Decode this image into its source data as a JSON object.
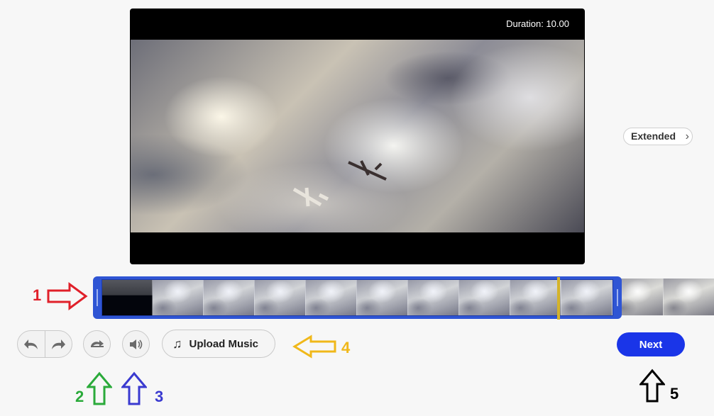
{
  "player": {
    "duration_label": "Duration: 10.00"
  },
  "extended": {
    "label": "Extended",
    "chevron": "›"
  },
  "timeline": {
    "thumbnail_count": 12,
    "playhead_icon": "playhead-marker"
  },
  "controls": {
    "undo_icon": "undo-icon",
    "redo_icon": "redo-icon",
    "loop_icon": "loop-icon",
    "volume_icon": "volume-icon",
    "upload_music_label": "Upload Music",
    "music_note": "♫",
    "next_label": "Next"
  },
  "annotations": {
    "n1": "1",
    "n2": "2",
    "n3": "3",
    "n4": "4",
    "n5": "5"
  },
  "colors": {
    "accent": "#1a35e8",
    "selection": "#2f55d4",
    "playhead": "#d4b32a",
    "ann1": "#e0202a",
    "ann2": "#2aaa3a",
    "ann3": "#3a3ad0",
    "ann4": "#f0b81a",
    "ann5": "#000000"
  }
}
